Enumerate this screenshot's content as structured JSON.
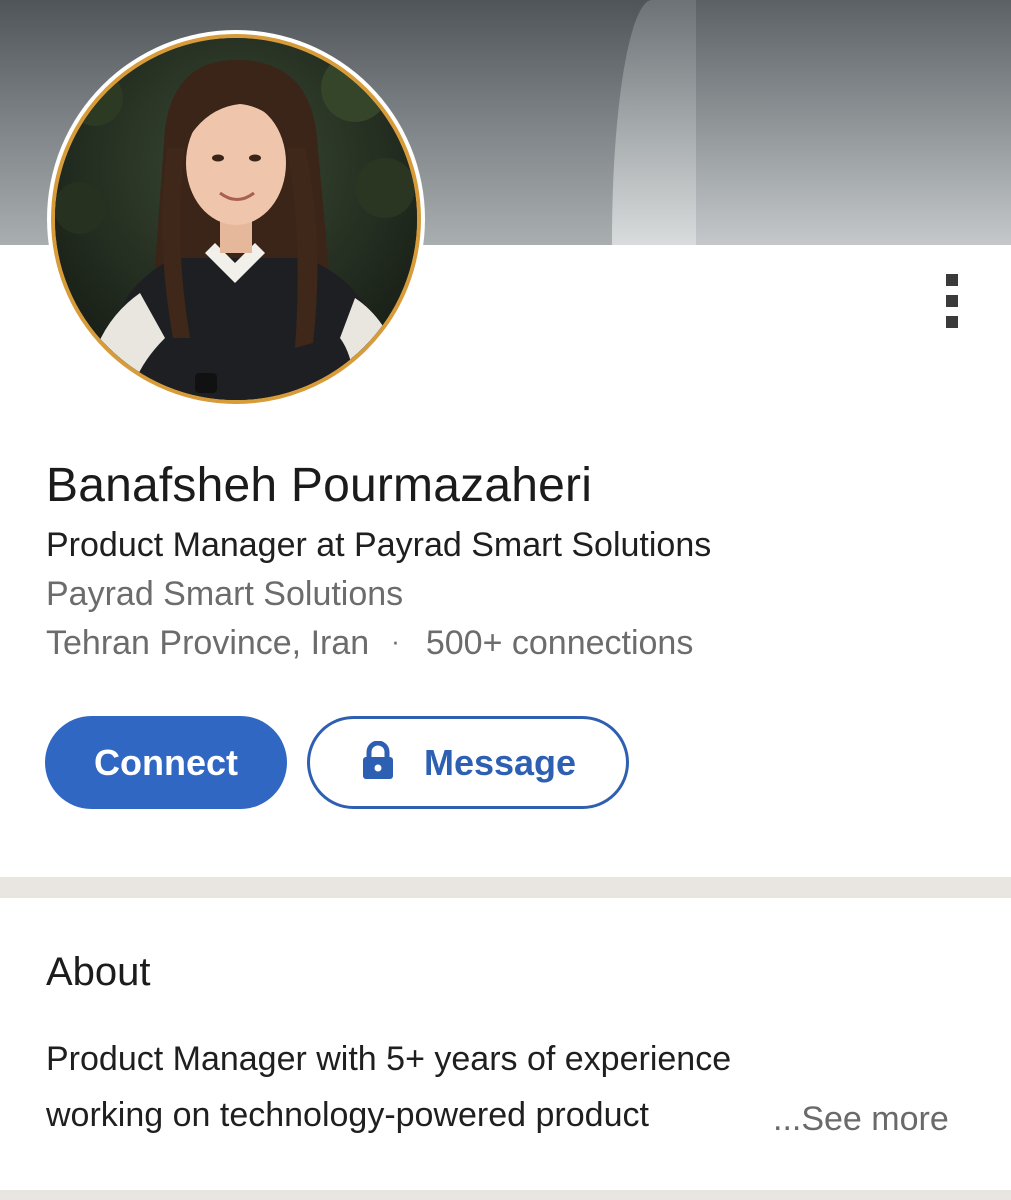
{
  "profile": {
    "name": "Banafsheh Pourmazaheri",
    "headline": "Product Manager at Payrad Smart Solutions",
    "company": "Payrad Smart Solutions",
    "location": "Tehran Province, Iran",
    "separator": "·",
    "connections": "500+ connections"
  },
  "actions": {
    "connect_label": "Connect",
    "message_label": "Message"
  },
  "about": {
    "title": "About",
    "line1": "Product Manager with 5+ years of experience",
    "line2": "working on technology-powered product",
    "see_more": "...See more"
  },
  "icons": {
    "menu": "more-vertical-icon",
    "lock": "lock-icon"
  },
  "colors": {
    "accent": "#2f67c3",
    "avatar_ring": "#d79b3a",
    "divider": "#e9e6e1"
  }
}
